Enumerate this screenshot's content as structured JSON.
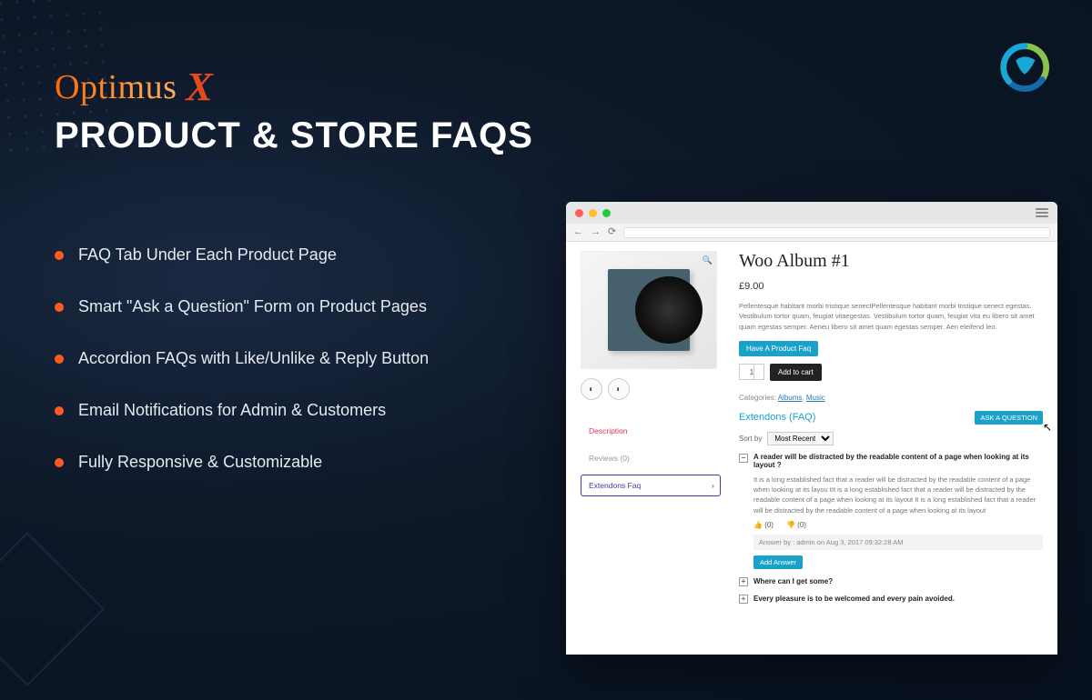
{
  "brand": {
    "name": "Optimus",
    "suffix": "X"
  },
  "title": "PRODUCT & STORE FAQS",
  "badge": {
    "name": "extendons-logo"
  },
  "features": [
    "FAQ Tab Under Each Product Page",
    "Smart \"Ask a Question\" Form on Product Pages",
    "Accordion FAQs with Like/Unlike & Reply Button",
    "Email Notifications for Admin & Customers",
    "Fully Responsive & Customizable"
  ],
  "preview": {
    "product": {
      "title": "Woo Album #1",
      "price": "£9.00",
      "description": "Pellentesque habitant morbi tristique senectPellentesque habitant morbi tristique senect egestas. Vestibulum tortor quam, feugiat vitaegestas. Vestibulum tortor quam, feugiat vita eu libero sit amet quam egestas semper. Aeneu libero sit amet quam egestas semper. Aen eleifend leo.",
      "faq_button": "Have A Product Faq",
      "qty": "1",
      "add_to_cart": "Add to cart",
      "categories_label": "Categories:",
      "categories": [
        "Albums",
        "Music"
      ]
    },
    "tabs": {
      "description": "Description",
      "reviews": "Reviews (0)",
      "extendons": "Extendons Faq"
    },
    "faq_panel": {
      "heading": "Extendons (FAQ)",
      "ask_button": "ASK A QUESTION",
      "sort_label": "Sort by",
      "sort_value": "Most Recent",
      "items": [
        {
          "expanded": true,
          "question": "A reader will be distracted by the readable content of a page when looking at its layout ?",
          "answer": "It is a long established fact that a reader will be distracted by the readable content of a page when looking at its layou tIt is a long established fact that a reader will be distracted by the readable content of a page when looking at its layout It is a long established fact that a reader will be distracted by the readable content of a page when looking at its layout",
          "likes": "(0)",
          "dislikes": "(0)",
          "answer_meta": "Answer by : admin on Aug 3, 2017 09:32:28 AM",
          "add_answer": "Add Answer"
        },
        {
          "expanded": false,
          "question": "Where can I get some?"
        },
        {
          "expanded": false,
          "question": "Every pleasure is to be welcomed and every pain avoided."
        }
      ]
    }
  }
}
